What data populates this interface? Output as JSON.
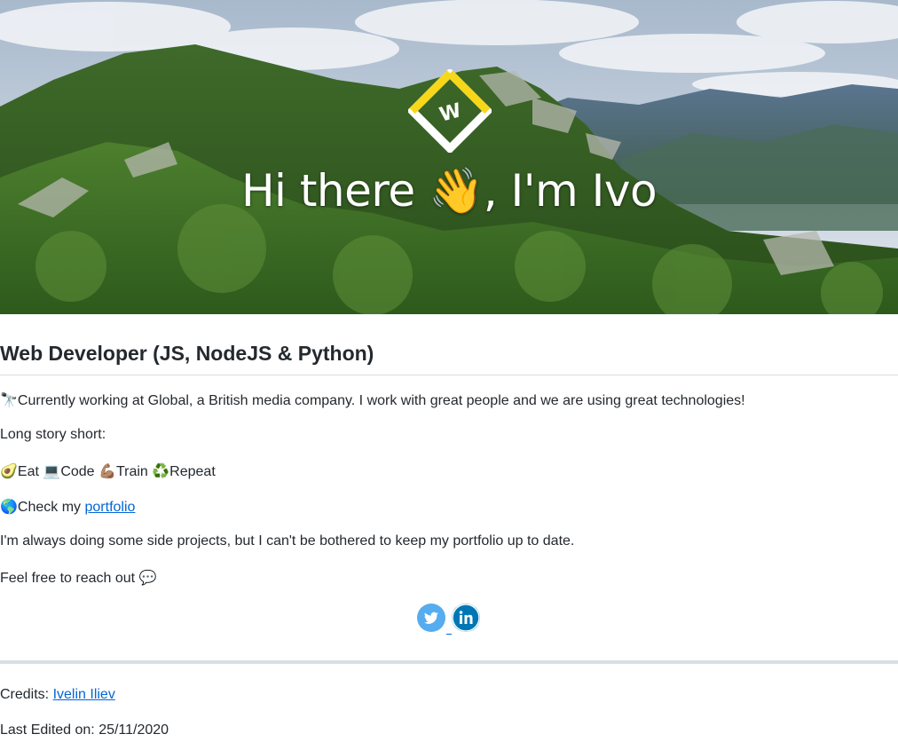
{
  "hero": {
    "title": "Hi there 👋, I'm Ivo",
    "logo_icon": "ivo-diamond-logo-icon",
    "colors": {
      "logo_yellow": "#f7d71a",
      "logo_white": "#ffffff",
      "sky": "#c9d6e3",
      "forest": "#2f5a1e"
    }
  },
  "heading": "Web Developer (JS, NodeJS & Python)",
  "intro": {
    "emoji": "🔭",
    "text": "Currently working at Global, a British media company. I work with great people and we are using great technologies!"
  },
  "story": "Long story short:",
  "routine": [
    {
      "emoji": "🥑",
      "label": "Eat"
    },
    {
      "emoji": "💻",
      "label": "Code"
    },
    {
      "emoji": "💪🏽",
      "label": "Train"
    },
    {
      "emoji": "♻️",
      "label": "Repeat"
    }
  ],
  "portfolio": {
    "emoji": "🌎",
    "prefix": "Check my ",
    "link_label": "portfolio"
  },
  "side_projects": "I'm always doing some side projects, but I can't be bothered to keep my portfolio up to date.",
  "reach_out": {
    "text": "Feel free to reach out ",
    "emoji": "💬"
  },
  "social": [
    {
      "icon": "twitter-icon",
      "color": "#55acee"
    },
    {
      "icon": "linkedin-icon",
      "color": "#0077b5"
    }
  ],
  "credits": {
    "prefix": "Credits: ",
    "link_label": "Ivelin Iliev"
  },
  "last_edited": "Last Edited on: 25/11/2020",
  "link_color": "#0366d6"
}
